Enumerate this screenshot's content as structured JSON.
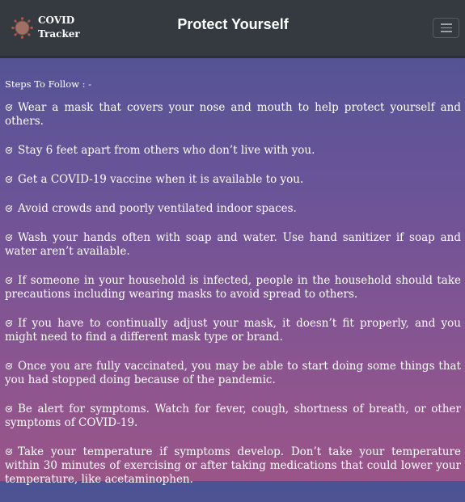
{
  "header": {
    "brand_line1": "COVID",
    "brand_line2": "Tracker",
    "title": "Protect Yourself"
  },
  "steps_heading": "Steps To Follow : -",
  "steps": [
    "Wear a mask that covers your nose and mouth to help protect yourself and others.",
    "Stay 6 feet apart from others who don’t live with you.",
    "Get a COVID-19 vaccine when it is available to you.",
    "Avoid crowds and poorly ventilated indoor spaces.",
    "Wash your hands often with soap and water. Use hand sanitizer if soap and water aren’t available.",
    "If someone in your household is infected, people in the household should take precautions including wearing masks to avoid spread to others.",
    "If you have to continually adjust your mask, it doesn’t fit properly, and you might need to find a different mask type or brand.",
    "Once you are fully vaccinated, you may be able to start doing some things that you had stopped doing because of the pandemic.",
    "Be alert for symptoms. Watch for fever, cough, shortness of breath, or other symptoms of COVID-19.",
    "Take your temperature if symptoms develop. Don’t take your temperature within 30 minutes of exercising or after taking medications that could lower your temperature, like acetaminophen."
  ],
  "colors": {
    "navbar": "#343a40",
    "gradient_top": "#4b5394",
    "gradient_bottom": "#9a5588"
  },
  "icons": {
    "brand": "virus-icon",
    "menu": "hamburger-icon",
    "bullet": "check-circle-icon"
  }
}
